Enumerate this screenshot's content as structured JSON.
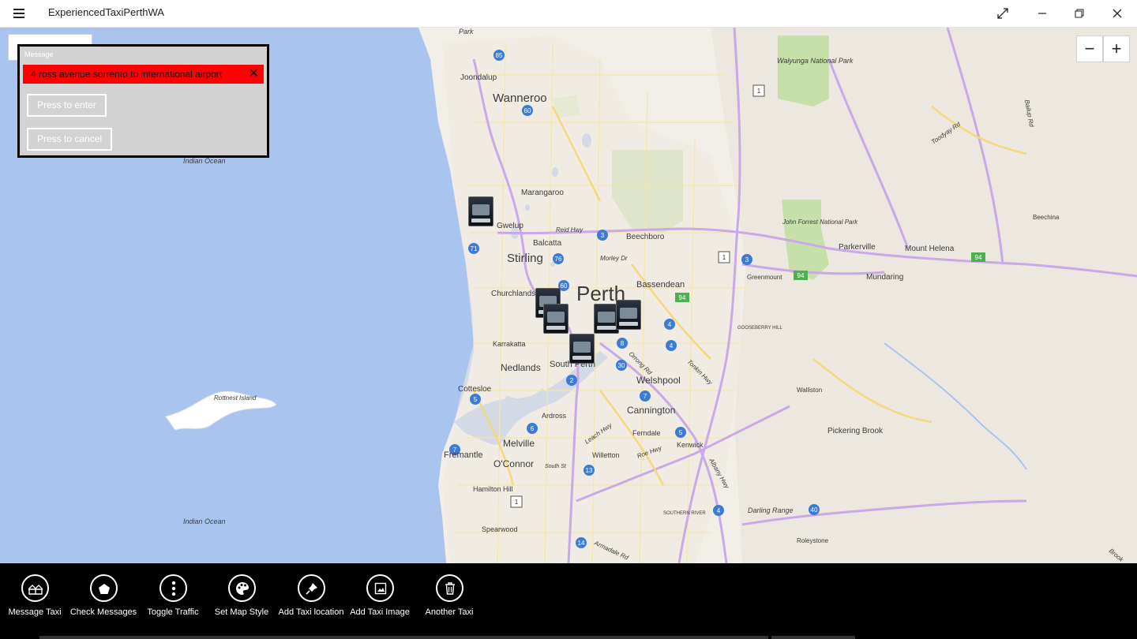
{
  "window": {
    "title": "ExperiencedTaxiPerthWA",
    "menu_icon": "hamburger-icon",
    "controls": [
      "fullscreen-icon",
      "minimize-icon",
      "restore-icon",
      "close-icon"
    ]
  },
  "map": {
    "zoom_out_label": "−",
    "zoom_in_label": "+",
    "labels": {
      "park": "Park",
      "joondalup": "Joondalup",
      "wanneroo": "Wanneroo",
      "walyunga": "Walyunga National Park",
      "marangaroo": "Marangaroo",
      "gwelup": "Gwelup",
      "balcatta": "Balcatta",
      "stirling": "Stirling",
      "beechboro": "Beechboro",
      "morley": "Morley Dr",
      "reid": "Reid Hwy",
      "bassendean": "Bassendean",
      "perth": "Perth",
      "churchlands": "Churchlands",
      "karrakatta": "Karrakatta",
      "nedlands": "Nedlands",
      "south_perth": "South Perth",
      "cottesloe": "Cottesloe",
      "welshpool": "Welshpool",
      "cannington": "Cannington",
      "ardross": "Ardross",
      "melville": "Melville",
      "fremantle": "Fremantle",
      "oconnor": "O'Connor",
      "ferndale": "Ferndale",
      "kenwick": "Kenwick",
      "willetton": "Willetton",
      "hamilton_hill": "Hamilton Hill",
      "spearwood": "Spearwood",
      "indian_ocean_1": "Indian Ocean",
      "indian_ocean_2": "Indian Ocean",
      "rottnest": "Rottnest Island",
      "john_forrest": "John Forrest National Park",
      "parkerville": "Parkerville",
      "mount_helena": "Mount Helena",
      "greenmount": "Greenmount",
      "mundaring": "Mundaring",
      "beechina": "Beechina",
      "walliston": "Walliston",
      "pickering_brook": "Pickering Brook",
      "darling_range": "Darling Range",
      "roleystone": "Roleystone",
      "southern_river": "SOUTHERN RIVER",
      "gooseberry_hill": "GOOSEBERRY HILL",
      "toodyay": "Toodyay Rd",
      "bailup": "Bailup Rd",
      "orrong": "Orrong Rd",
      "tonkin": "Tonkin Hwy",
      "leach": "Leach Hwy",
      "roe": "Roe Hwy",
      "albany": "Albany Hwy",
      "armadale": "Armadale Rd",
      "south_st": "South St",
      "brookton": "Brook"
    }
  },
  "message_dialog": {
    "caption": "Message",
    "message_value": "4 ross avenue sorrento to international airport",
    "clear_symbol": "✕",
    "enter_label": "Press to enter",
    "cancel_label": "Press to cancel"
  },
  "app_bar": {
    "buttons": [
      {
        "label": "Message Taxi",
        "icon": "message-taxi-icon"
      },
      {
        "label": "Check Messages",
        "icon": "home-icon"
      },
      {
        "label": "Toggle Traffic",
        "icon": "more-vertical-icon"
      },
      {
        "label": "Set Map Style",
        "icon": "palette-icon"
      },
      {
        "label": "Add Taxi location",
        "icon": "pin-icon"
      },
      {
        "label": "Add Taxi Image",
        "icon": "image-icon"
      },
      {
        "label": "Another Taxi",
        "icon": "trash-icon"
      }
    ]
  }
}
